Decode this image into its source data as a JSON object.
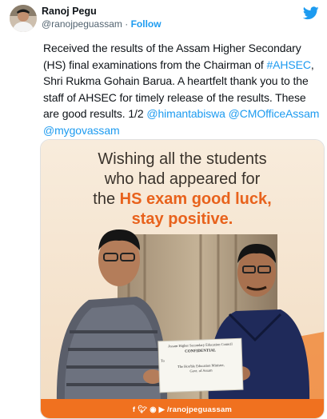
{
  "author": {
    "display_name": "Ranoj Pegu",
    "handle": "@ranojpeguassam",
    "separator": " · ",
    "follow_label": "Follow"
  },
  "tweet": {
    "text_part1": "Received the results of the Assam Higher Secondary (HS) final examinations from the Chairman of ",
    "hashtag": "#AHSEC",
    "text_part2": ", Shri Rukma Gohain Barua. A heartfelt thank you to the staff of AHSEC for timely release of the results. These are good results. 1/2 ",
    "mention1": "@himantabiswa",
    "mention2": "@CMOfficeAssam",
    "mention3": "@mygovassam"
  },
  "media": {
    "line1": "Wishing all the students",
    "line2": "who had appeared for",
    "line3_pre": "the ",
    "line3_highlight": "HS exam good luck,",
    "line4_highlight": "stay positive.",
    "envelope_header": "Assam Higher Secondary Education Council",
    "envelope_title": "CONFIDENTIAL",
    "envelope_to": "To",
    "envelope_line1": "The Hon'ble Education Minister,",
    "envelope_line2": "Govt. of Assam",
    "footer_handle": "/ranojpeguassam"
  },
  "colors": {
    "accent_orange": "#f0711f",
    "link_blue": "#1d9bf0"
  },
  "icons": [
    "twitter-bird-icon",
    "facebook-icon",
    "twitter-icon",
    "instagram-icon",
    "youtube-icon"
  ]
}
